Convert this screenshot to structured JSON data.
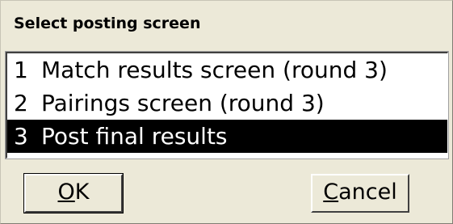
{
  "dialog": {
    "title": "Select posting screen",
    "items": [
      {
        "number": "1",
        "label": "Match results screen (round 3)",
        "selected": false
      },
      {
        "number": "2",
        "label": "Pairings screen (round 3)",
        "selected": false
      },
      {
        "number": "3",
        "label": "Post final results",
        "selected": true
      }
    ],
    "ok_button": {
      "accel": "O",
      "rest": "K"
    },
    "cancel_button": {
      "accel": "C",
      "rest": "ancel"
    }
  },
  "colors": {
    "dialog_bg": "#ece9d8",
    "selection_bg": "#000000",
    "selection_fg": "#ffffff"
  }
}
